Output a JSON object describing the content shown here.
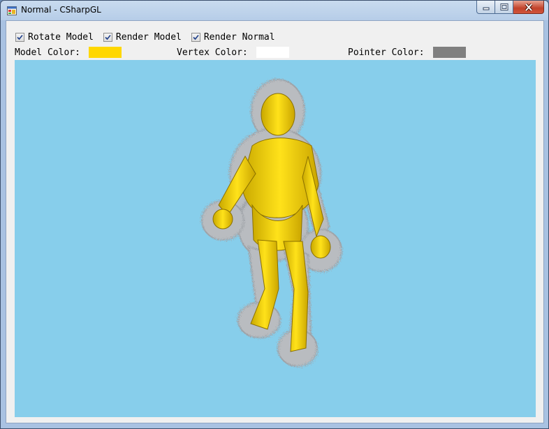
{
  "window": {
    "title": "Normal - CSharpGL",
    "icon": "app-icon",
    "caption_buttons": [
      "minimize-icon",
      "maximize-icon",
      "close-icon"
    ]
  },
  "options": {
    "rotate_model": {
      "label": "Rotate Model",
      "checked": true
    },
    "render_model": {
      "label": "Render Model",
      "checked": true
    },
    "render_normal": {
      "label": "Render Normal",
      "checked": true
    }
  },
  "colors": {
    "model_color_label": "Model Color:",
    "model_color": "#ffd700",
    "vertex_color_label": "Vertex Color:",
    "vertex_color": "#ffffff",
    "pointer_color_label": "Pointer Color:",
    "pointer_color": "#808080"
  },
  "viewport": {
    "background": "#87ceeb",
    "content": "humanoid-model-with-normals"
  }
}
